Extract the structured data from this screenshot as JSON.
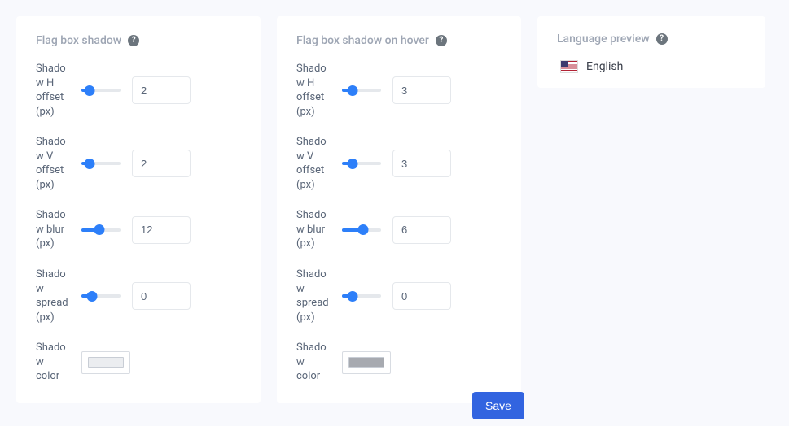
{
  "panelA": {
    "title": "Flag box shadow",
    "fields": [
      {
        "label": "Shadow H offset (px)",
        "value": "2",
        "fillPct": 20
      },
      {
        "label": "Shadow V offset (px)",
        "value": "2",
        "fillPct": 20
      },
      {
        "label": "Shadow blur (px)",
        "value": "12",
        "fillPct": 45
      },
      {
        "label": "Shadow spread (px)",
        "value": "0",
        "fillPct": 28
      }
    ],
    "colorLabel": "Shadow color",
    "colorSwatch": "#ebedf0"
  },
  "panelB": {
    "title": "Flag box shadow on hover",
    "fields": [
      {
        "label": "Shadow H offset (px)",
        "value": "3",
        "fillPct": 28
      },
      {
        "label": "Shadow V offset (px)",
        "value": "3",
        "fillPct": 28
      },
      {
        "label": "Shadow blur (px)",
        "value": "6",
        "fillPct": 55
      },
      {
        "label": "Shadow spread (px)",
        "value": "0",
        "fillPct": 28
      }
    ],
    "colorLabel": "Shadow color",
    "colorSwatch": "#a7aab0"
  },
  "preview": {
    "title": "Language preview",
    "langLabel": "English"
  },
  "saveLabel": "Save"
}
